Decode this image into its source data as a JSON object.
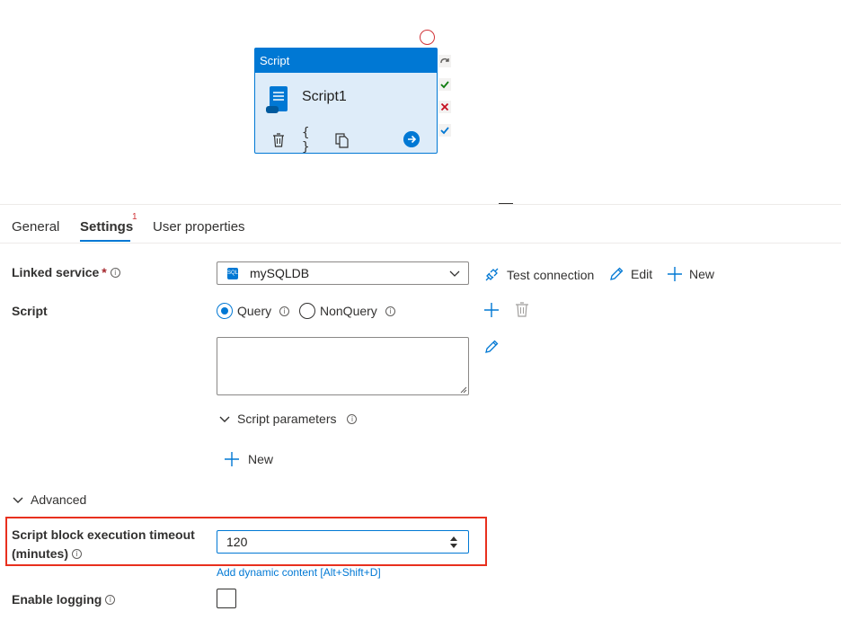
{
  "activity": {
    "type_label": "Script",
    "name": "Script1",
    "icons": [
      "scroll-icon",
      "trash-icon",
      "code-braces-icon",
      "copy-icon",
      "arrow-right-icon"
    ],
    "side_icons": [
      "skip-arrow-icon",
      "success-check-icon",
      "failure-x-icon",
      "completion-check-icon"
    ]
  },
  "tabs": [
    {
      "label": "General",
      "active": false
    },
    {
      "label": "Settings",
      "active": true,
      "badge": "1"
    },
    {
      "label": "User properties",
      "active": false
    }
  ],
  "linked_service": {
    "label": "Linked service",
    "required": "*",
    "value": "mySQLDB",
    "test_connection": "Test connection",
    "edit": "Edit",
    "new": "New"
  },
  "script": {
    "label": "Script",
    "options": [
      {
        "label": "Query",
        "selected": true
      },
      {
        "label": "NonQuery",
        "selected": false
      }
    ],
    "text": "",
    "parameters_label": "Script parameters",
    "new_label": "New"
  },
  "advanced": {
    "label": "Advanced",
    "timeout_label_1": "Script block execution timeout",
    "timeout_label_2": "(minutes)",
    "timeout_value": "120",
    "dynamic_content": "Add dynamic content [Alt+Shift+D]",
    "logging_label": "Enable logging",
    "logging_enabled": false
  },
  "colors": {
    "accent": "#0078d4",
    "highlight": "#e8301e",
    "error": "#d13438",
    "success": "#107c10"
  }
}
